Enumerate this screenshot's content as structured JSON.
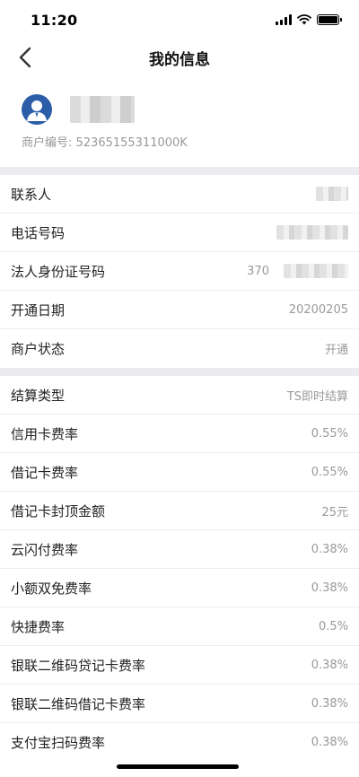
{
  "status_bar": {
    "time": "11:20",
    "icons": [
      "signal-icon",
      "wifi-icon",
      "battery-icon"
    ]
  },
  "nav": {
    "title": "我的信息",
    "back_icon": "chevron-left-icon"
  },
  "profile": {
    "avatar_icon": "user-avatar-icon",
    "merchant_no": "商户编号: 52365155311000K"
  },
  "section1": [
    {
      "label": "联系人",
      "value": ""
    },
    {
      "label": "电话号码",
      "value": ""
    },
    {
      "label": "法人身份证号码",
      "value": "370"
    },
    {
      "label": "开通日期",
      "value": "20200205"
    },
    {
      "label": "商户状态",
      "value": "开通"
    }
  ],
  "section2": [
    {
      "label": "结算类型",
      "value": "TS即时结算"
    },
    {
      "label": "信用卡费率",
      "value": "0.55%"
    },
    {
      "label": "借记卡费率",
      "value": "0.55%"
    },
    {
      "label": "借记卡封顶金额",
      "value": "25元"
    },
    {
      "label": "云闪付费率",
      "value": "0.38%"
    },
    {
      "label": "小额双免费率",
      "value": "0.38%"
    },
    {
      "label": "快捷费率",
      "value": "0.5%"
    },
    {
      "label": "银联二维码贷记卡费率",
      "value": "0.38%"
    },
    {
      "label": "银联二维码借记卡费率",
      "value": "0.38%"
    },
    {
      "label": "支付宝扫码费率",
      "value": "0.38%"
    }
  ],
  "colors": {
    "accent": "#2b5da8",
    "separator": "#ebebf0",
    "muted_text": "#999999"
  }
}
